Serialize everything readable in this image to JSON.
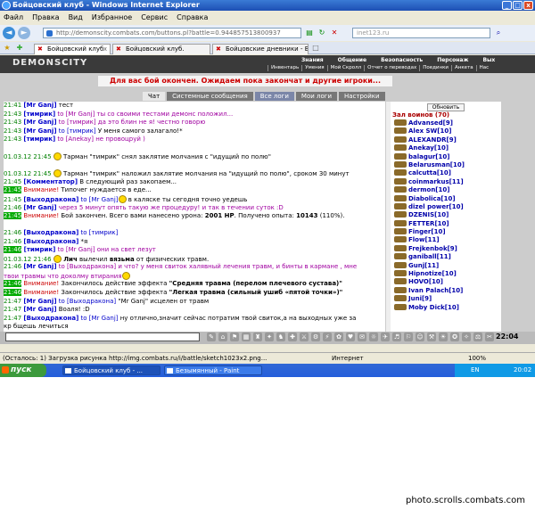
{
  "window": {
    "title": "Бойцовский клуб - Windows Internet Explorer",
    "buttons": [
      "_",
      "□",
      "x"
    ]
  },
  "menu": [
    "Файл",
    "Правка",
    "Вид",
    "Избранное",
    "Сервис",
    "Справка"
  ],
  "address": {
    "url": "http://demonscity.combats.com/buttons.pl?battle=0.944857513800937",
    "search_placeholder": "inet123.ru"
  },
  "tabs": [
    {
      "label": "Бойцовский клуб",
      "active": true
    },
    {
      "label": "Бойцовский клуб.",
      "active": false
    },
    {
      "label": "Бойцовские дневники - Вы...",
      "active": false
    }
  ],
  "game": {
    "logo": "DEMONSCITY",
    "top_nav": [
      "Знания",
      "Общение",
      "Безопасность",
      "Персонаж",
      "Вых"
    ],
    "sub_nav": [
      "Инвентарь",
      "Умения",
      "Мой Скролл",
      "Отчет о переводах",
      "Поединки",
      "Анкета",
      "Нас"
    ],
    "status_message": "Для вас бой окончен. Ожидаем пока закончат и другие игроки...",
    "chat_tabs": [
      "Чат",
      "Системные сообщения",
      "Все логи",
      "Мои логи",
      "Настройки"
    ],
    "clock": "22:04"
  },
  "chat": [
    [
      {
        "c": "ts",
        "t": "21:41 "
      },
      {
        "c": "nick",
        "t": "[Mr Ganj]"
      },
      {
        "c": "",
        "t": " тест"
      }
    ],
    [
      {
        "c": "ts",
        "t": "21:43 "
      },
      {
        "c": "nick",
        "t": "[тимрик]"
      },
      {
        "c": "priv",
        "t": " to [Mr Ganj] ты со своими тестами демонс положил..."
      }
    ],
    [
      {
        "c": "ts",
        "t": "21:43 "
      },
      {
        "c": "nick",
        "t": "[Mr Ganj]"
      },
      {
        "c": "priv",
        "t": " to [тимрик] да это блин не я! честно говорю"
      }
    ],
    [
      {
        "c": "ts",
        "t": "21:43 "
      },
      {
        "c": "nick",
        "t": "[Mr Ganj]"
      },
      {
        "c": "to",
        "t": " to [тимрик] "
      },
      {
        "c": "",
        "t": "У меня самого залагало!*"
      }
    ],
    [
      {
        "c": "ts",
        "t": "21:43 "
      },
      {
        "c": "nick",
        "t": "[тимрик]"
      },
      {
        "c": "priv",
        "t": " to [Anekay] не провоцруй )"
      }
    ],
    [
      {
        "c": "",
        "t": " "
      }
    ],
    [
      {
        "c": "ts",
        "t": "01.03.12 21:45 "
      },
      {
        "c": "smile",
        "t": ""
      },
      {
        "c": "",
        "t": "  Тарман \"тимрик\" снял заклятие молчания с \"идущий по полю\""
      }
    ],
    [
      {
        "c": "",
        "t": " "
      }
    ],
    [
      {
        "c": "ts",
        "t": "01.03.12 21:45 "
      },
      {
        "c": "smile",
        "t": ""
      },
      {
        "c": "",
        "t": "  Тарман \"тимрик\" наложил заклятие молчания на \"идущий по полю\", сроком 30 минут"
      }
    ],
    [
      {
        "c": "ts",
        "t": "21:45 "
      },
      {
        "c": "nick",
        "t": "[Комментатор]"
      },
      {
        "c": "",
        "t": " В следующий раз закопаем..."
      }
    ],
    [
      {
        "c": "tsh",
        "t": "21:45"
      },
      {
        "c": "red",
        "t": " Внимание!"
      },
      {
        "c": "",
        "t": " Типочег нуждается в еде..."
      }
    ],
    [
      {
        "c": "ts",
        "t": "21:45 "
      },
      {
        "c": "nick",
        "t": "[Выходракона]"
      },
      {
        "c": "to",
        "t": " to [Mr Ganj]"
      },
      {
        "c": "smile",
        "t": ""
      },
      {
        "c": "",
        "t": " в каляске ты сегодня точно уедешь"
      }
    ],
    [
      {
        "c": "ts",
        "t": "21:46 "
      },
      {
        "c": "nick",
        "t": "[Mr Ganj]"
      },
      {
        "c": "priv",
        "t": " через 5 минут опять такую же процедуру! и так в течении суток :D"
      }
    ],
    [
      {
        "c": "tsh",
        "t": "21:45"
      },
      {
        "c": "red",
        "t": " Внимание!"
      },
      {
        "c": "",
        "t": " Бой закончен. Всего вами нанесено урона: "
      },
      {
        "c": "bold",
        "t": "2001 HP"
      },
      {
        "c": "",
        "t": ". Получено опыта: "
      },
      {
        "c": "bold",
        "t": "10143"
      },
      {
        "c": "",
        "t": " (110%)."
      }
    ],
    [
      {
        "c": "",
        "t": " "
      }
    ],
    [
      {
        "c": "ts",
        "t": "21:46 "
      },
      {
        "c": "nick",
        "t": "[Выходракона]"
      },
      {
        "c": "to",
        "t": " to [тимрик]"
      }
    ],
    [
      {
        "c": "ts",
        "t": "21:46 "
      },
      {
        "c": "nick",
        "t": "[Выходракона]"
      },
      {
        "c": "",
        "t": " *я"
      }
    ],
    [
      {
        "c": "tsh",
        "t": "21:46"
      },
      {
        "c": "nick",
        "t": " [тимрик]"
      },
      {
        "c": "priv",
        "t": " to [Mr Ganj] они на свет лезут"
      }
    ],
    [
      {
        "c": "ts",
        "t": "01.03.12 21:46 "
      },
      {
        "c": "smile",
        "t": ""
      },
      {
        "c": "bold",
        "t": "  Лич"
      },
      {
        "c": "",
        "t": " вылечил "
      },
      {
        "c": "bold",
        "t": "вязьма"
      },
      {
        "c": "",
        "t": " от физических травм."
      }
    ],
    [
      {
        "c": "ts",
        "t": "21:46 "
      },
      {
        "c": "nick",
        "t": "[Mr Ganj]"
      },
      {
        "c": "priv",
        "t": " to [Выходракона] и что? у меня свиток халявный лечения травм, и бинты в кармане , мне"
      }
    ],
    [
      {
        "c": "priv",
        "t": "твои травмы что доколму втирания"
      },
      {
        "c": "smile",
        "t": ""
      }
    ],
    [
      {
        "c": "tsh",
        "t": "21:46"
      },
      {
        "c": "red",
        "t": " Внимание!"
      },
      {
        "c": "",
        "t": " Закончилось действие эффекта "
      },
      {
        "c": "bold",
        "t": "\"Средняя травма (перелом плечевого сустава)\""
      }
    ],
    [
      {
        "c": "tsh",
        "t": "21:46"
      },
      {
        "c": "red",
        "t": " Внимание!"
      },
      {
        "c": "",
        "t": " Закончилось действие эффекта "
      },
      {
        "c": "bold",
        "t": "\"Легкая травма (сильный ушиб «пятой точки»)\""
      }
    ],
    [
      {
        "c": "ts",
        "t": "21:47 "
      },
      {
        "c": "nick",
        "t": "[Mr Ganj]"
      },
      {
        "c": "to",
        "t": " to [Выходракона] "
      },
      {
        "c": "",
        "t": "\"Mr Ganj\" исцелен от травм"
      }
    ],
    [
      {
        "c": "ts",
        "t": "21:47 "
      },
      {
        "c": "nick",
        "t": "[Mr Ganj]"
      },
      {
        "c": "",
        "t": " Воаля! :D"
      }
    ],
    [
      {
        "c": "ts",
        "t": "21:47 "
      },
      {
        "c": "nick",
        "t": "[Выходракона]"
      },
      {
        "c": "to",
        "t": " to [Mr Ganj]"
      },
      {
        "c": "",
        "t": " ну отлично,значит сейчас потратим твой свиток,а на выходных уже за"
      }
    ],
    [
      {
        "c": "",
        "t": "кр бщешь лечиться"
      }
    ],
    [
      {
        "c": "ts",
        "t": "21:47 "
      },
      {
        "c": "nick",
        "t": "[Mr Ganj]"
      },
      {
        "c": "priv",
        "t": " to [Выходракона] зато я, в отличии от тебя , иксны срубил"
      },
      {
        "c": "smile",
        "t": ""
      }
    ],
    [
      {
        "c": "ts",
        "t": "21:47 "
      },
      {
        "c": "nick",
        "t": "[Anekay]"
      },
      {
        "c": "priv",
        "t": " to [тимрик] начальник, не пугай"
      }
    ]
  ],
  "sidebar": {
    "refresh_label": "Обновить",
    "header": "Зал воинов (70)",
    "players": [
      "Advansed[9]",
      "Alex SW[10]",
      "ALEXANDR[9]",
      "Anekay[10]",
      "balagur[10]",
      "Belarusman[10]",
      "calcutta[10]",
      "coinmarkus[11]",
      "dermon[10]",
      "Diabolica[10]",
      "dizel power[10]",
      "DZENIS[10]",
      "FETTER[10]",
      "Finger[10]",
      "Flow[11]",
      "Frejkenbok[9]",
      "ganiball[11]",
      "Gunj[11]",
      "Hipnotize[10]",
      "HOVO[10]",
      "Ivan Palach[10]",
      "Juni[9]",
      "Moby Dick[10]"
    ]
  },
  "ie_status": {
    "text": "(Осталось: 1) Загрузка рисунка http://img.combats.ru/i/battle/sketch1023x2.png...",
    "zone": "Интернет",
    "zoom": "100%"
  },
  "taskbar": {
    "start": "пуск",
    "tasks": [
      "Бойцовский клуб - ...",
      "Безымянный - Paint"
    ],
    "lang": "EN",
    "time": "20:02"
  },
  "watermark": "photo.scrolls.combats.com"
}
